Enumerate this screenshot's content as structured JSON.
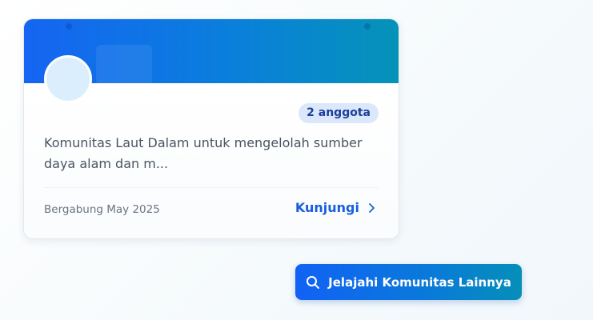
{
  "community_card": {
    "member_badge": "2 anggota",
    "description": "Komunitas Laut Dalam untuk mengelolah sumber daya alam dan m...",
    "joined_text": "Bergabung May 2025",
    "visit_label": "Kunjungi",
    "visit_icon": "chevron-right-icon",
    "avatar_color": "#dbeefe",
    "banner_colors": [
      "#1565f2",
      "#0593b8"
    ]
  },
  "explore_button": {
    "label": "Jelajahi Komunitas Lainnya",
    "icon": "search-icon",
    "colors": [
      "#1162f5",
      "#058fb8"
    ]
  }
}
